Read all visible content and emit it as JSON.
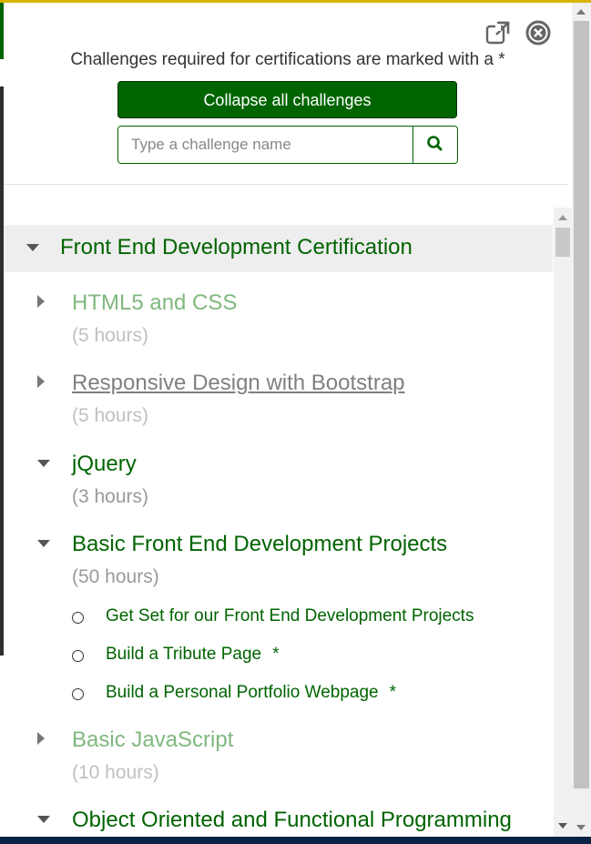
{
  "header": {
    "note": "Challenges required for certifications are marked with a *",
    "collapse_label": "Collapse all challenges",
    "search_placeholder": "Type a challenge name",
    "icons": {
      "popout": "external-link-icon",
      "close": "close-circle-icon",
      "search": "search-icon"
    }
  },
  "certification": {
    "title": "Front End Development Certification",
    "expanded": true
  },
  "blocks": [
    {
      "title": "HTML5 and CSS",
      "hours": "(5 hours)",
      "expanded": false
    },
    {
      "title": "Responsive Design with Bootstrap",
      "hours": "(5 hours)",
      "expanded": false
    },
    {
      "title": "jQuery",
      "hours": "(3 hours)",
      "expanded": true
    },
    {
      "title": "Basic Front End Development Projects",
      "hours": "(50 hours)",
      "expanded": true,
      "challenges": [
        {
          "title": "Get Set for our Front End Development Projects",
          "required": ""
        },
        {
          "title": "Build a Tribute Page",
          "required": "*"
        },
        {
          "title": "Build a Personal Portfolio Webpage",
          "required": "*"
        }
      ]
    },
    {
      "title": "Basic JavaScript",
      "hours": "(10 hours)",
      "expanded": false
    },
    {
      "title": "Object Oriented and Functional Programming",
      "hours": "",
      "expanded": true
    }
  ],
  "colors": {
    "brand_green": "#006400",
    "light_green": "#7fb87f",
    "section_bg": "#eeeeee",
    "muted": "#c0c0c0"
  }
}
